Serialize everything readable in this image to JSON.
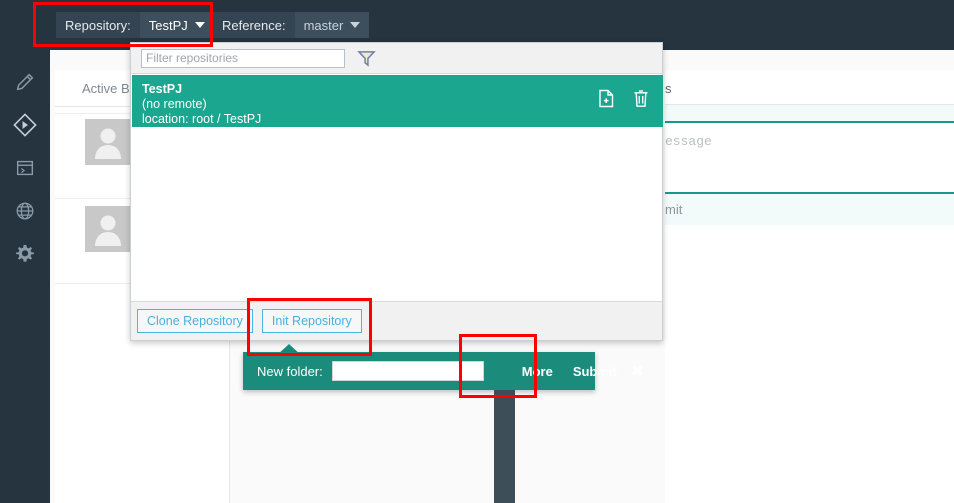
{
  "header": {
    "repository_label": "Repository:",
    "repository_value": "TestPJ",
    "reference_label": "Reference:",
    "reference_value": "master"
  },
  "sidebar": {
    "items": [
      {
        "icon": "pencil-icon",
        "name": "edit"
      },
      {
        "icon": "git-diamond-icon",
        "name": "source-control"
      },
      {
        "icon": "terminal-icon",
        "name": "terminal"
      },
      {
        "icon": "globe-icon",
        "name": "browser"
      },
      {
        "icon": "gear-icon",
        "name": "settings"
      }
    ]
  },
  "background": {
    "left_tab_label": "Active Bra",
    "right_tab_label": "s",
    "commit_message_placeholder": "essage",
    "commit_button_label": "mit"
  },
  "repo_panel": {
    "filter_placeholder": "Filter repositories",
    "filter_value": "",
    "filter_icon": "funnel-icon",
    "repositories": [
      {
        "name": "TestPJ",
        "remote": "(no remote)",
        "location": "location: root / TestPJ",
        "selected": true,
        "actions": [
          "new-file-icon",
          "trash-icon"
        ]
      }
    ],
    "clone_button_label": "Clone Repository",
    "init_button_label": "Init Repository"
  },
  "new_folder_bar": {
    "label": "New folder:",
    "value": "",
    "more_label": "More",
    "submit_label": "Submit",
    "close_icon": "close-icon"
  },
  "colors": {
    "header_bg": "#263440",
    "accent_green": "#1aa68f",
    "toolbar_green": "#1b8c7c",
    "link_blue": "#49b0dc",
    "annotation_red": "#ff0000"
  },
  "annotations": [
    {
      "name": "repository-selector-highlight"
    },
    {
      "name": "init-repository-highlight"
    },
    {
      "name": "more-button-highlight"
    }
  ]
}
